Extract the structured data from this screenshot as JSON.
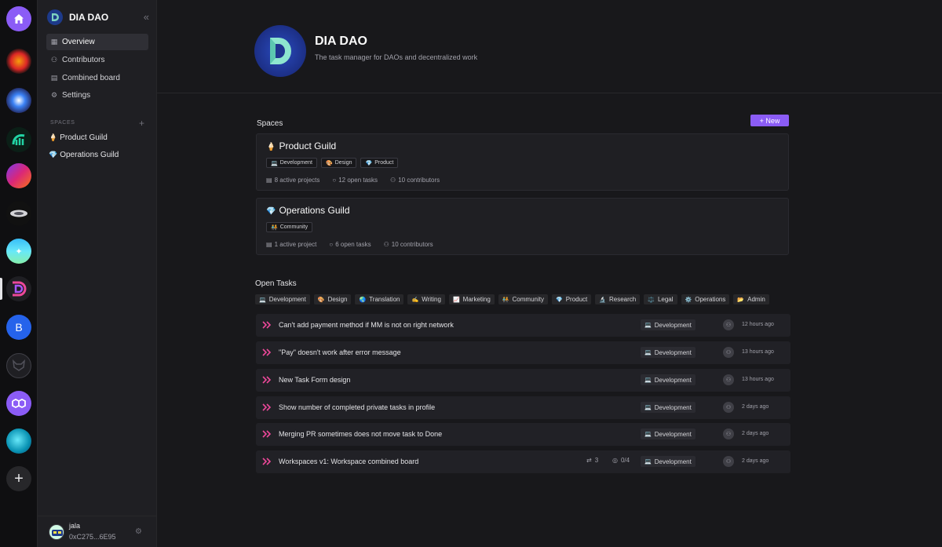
{
  "org": {
    "name": "DIA DAO",
    "tagline": "The task manager for DAOs and decentralized work",
    "collapse_glyph": "«"
  },
  "nav": {
    "items": [
      {
        "label": "Overview",
        "icon": "grid-icon"
      },
      {
        "label": "Contributors",
        "icon": "users-icon"
      },
      {
        "label": "Combined board",
        "icon": "board-icon"
      },
      {
        "label": "Settings",
        "icon": "gear-icon"
      }
    ],
    "spaces_label": "SPACES",
    "spaces": [
      {
        "emoji": "🍦",
        "label": "Product Guild"
      },
      {
        "emoji": "💎",
        "label": "Operations Guild"
      }
    ]
  },
  "user": {
    "name": "jala",
    "address": "0xC275...6E95"
  },
  "spaces_section": {
    "title": "Spaces",
    "new_button": "+ New",
    "cards": [
      {
        "emoji": "🍦",
        "title": "Product Guild",
        "tags": [
          {
            "emoji": "💻",
            "label": "Development"
          },
          {
            "emoji": "🎨",
            "label": "Design"
          },
          {
            "emoji": "💎",
            "label": "Product"
          }
        ],
        "stats": {
          "projects": "8 active projects",
          "tasks": "12 open tasks",
          "contributors": "10 contributors"
        }
      },
      {
        "emoji": "💎",
        "title": "Operations Guild",
        "tags": [
          {
            "emoji": "🧑‍🤝‍🧑",
            "label": "Community"
          }
        ],
        "stats": {
          "projects": "1 active project",
          "tasks": "6 open tasks",
          "contributors": "10 contributors"
        }
      }
    ]
  },
  "tasks_section": {
    "title": "Open Tasks",
    "filters": [
      {
        "emoji": "💻",
        "label": "Development"
      },
      {
        "emoji": "🎨",
        "label": "Design"
      },
      {
        "emoji": "🌏",
        "label": "Translation"
      },
      {
        "emoji": "✍️",
        "label": "Writing"
      },
      {
        "emoji": "📈",
        "label": "Marketing"
      },
      {
        "emoji": "🧑‍🤝‍🧑",
        "label": "Community"
      },
      {
        "emoji": "💎",
        "label": "Product"
      },
      {
        "emoji": "🔬",
        "label": "Research"
      },
      {
        "emoji": "⚖️",
        "label": "Legal"
      },
      {
        "emoji": "⚙️",
        "label": "Operations"
      },
      {
        "emoji": "📂",
        "label": "Admin"
      }
    ],
    "tasks": [
      {
        "title": "Can't add payment method if MM is not on right network",
        "tag": "Development",
        "tag_emoji": "💻",
        "time": "12 hours ago"
      },
      {
        "title": "\"Pay\" doesn't work after error message",
        "tag": "Development",
        "tag_emoji": "💻",
        "time": "13 hours ago"
      },
      {
        "title": "New Task Form design",
        "tag": "Development",
        "tag_emoji": "💻",
        "time": "13 hours ago"
      },
      {
        "title": "Show number of completed private tasks in profile",
        "tag": "Development",
        "tag_emoji": "💻",
        "time": "2 days ago"
      },
      {
        "title": "Merging PR sometimes does not move task to Done",
        "tag": "Development",
        "tag_emoji": "💻",
        "time": "2 days ago"
      },
      {
        "title": "Workspaces v1: Workspace combined board",
        "tag": "Development",
        "tag_emoji": "💻",
        "time": "2 days ago",
        "pr_count": "3",
        "subtasks": "0/4"
      }
    ]
  },
  "colors": {
    "accent": "#8b5cf6",
    "chevron": "#ec4899",
    "background": "#18181b"
  }
}
